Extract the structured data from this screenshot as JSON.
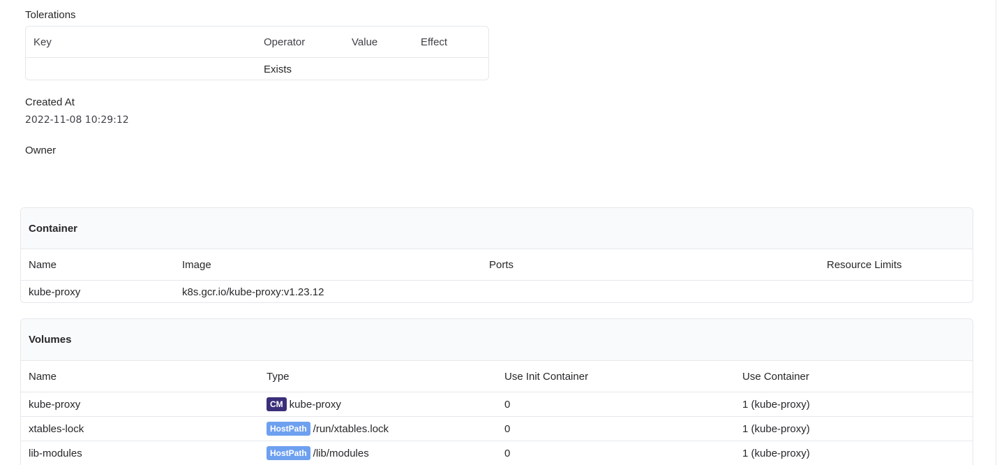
{
  "tolerations": {
    "label": "Tolerations",
    "headers": {
      "key": "Key",
      "operator": "Operator",
      "value": "Value",
      "effect": "Effect"
    },
    "rows": [
      {
        "key": "",
        "operator": "Exists",
        "value": "",
        "effect": ""
      }
    ]
  },
  "created_at": {
    "label": "Created At",
    "value": "2022-11-08 10:29:12"
  },
  "owner": {
    "label": "Owner"
  },
  "container": {
    "title": "Container",
    "headers": {
      "name": "Name",
      "image": "Image",
      "ports": "Ports",
      "resource_limits": "Resource Limits"
    },
    "rows": [
      {
        "name": "kube-proxy",
        "image": "k8s.gcr.io/kube-proxy:v1.23.12",
        "ports": "",
        "resource_limits": ""
      }
    ]
  },
  "volumes": {
    "title": "Volumes",
    "headers": {
      "name": "Name",
      "type": "Type",
      "use_init_container": "Use Init Container",
      "use_container": "Use Container"
    },
    "rows": [
      {
        "name": "kube-proxy",
        "type_badge": "CM",
        "type_value": "kube-proxy",
        "use_init_container": "0",
        "use_container": "1 (kube-proxy)"
      },
      {
        "name": "xtables-lock",
        "type_badge": "HostPath",
        "type_value": "/run/xtables.lock",
        "use_init_container": "0",
        "use_container": "1 (kube-proxy)"
      },
      {
        "name": "lib-modules",
        "type_badge": "HostPath",
        "type_value": "/lib/modules",
        "use_init_container": "0",
        "use_container": "1 (kube-proxy)"
      }
    ]
  },
  "colors": {
    "cm_badge": "#3b2f7a",
    "hostpath_badge": "#6ea0f0",
    "border": "#e5e7eb",
    "header_bg": "#f9fafb"
  }
}
